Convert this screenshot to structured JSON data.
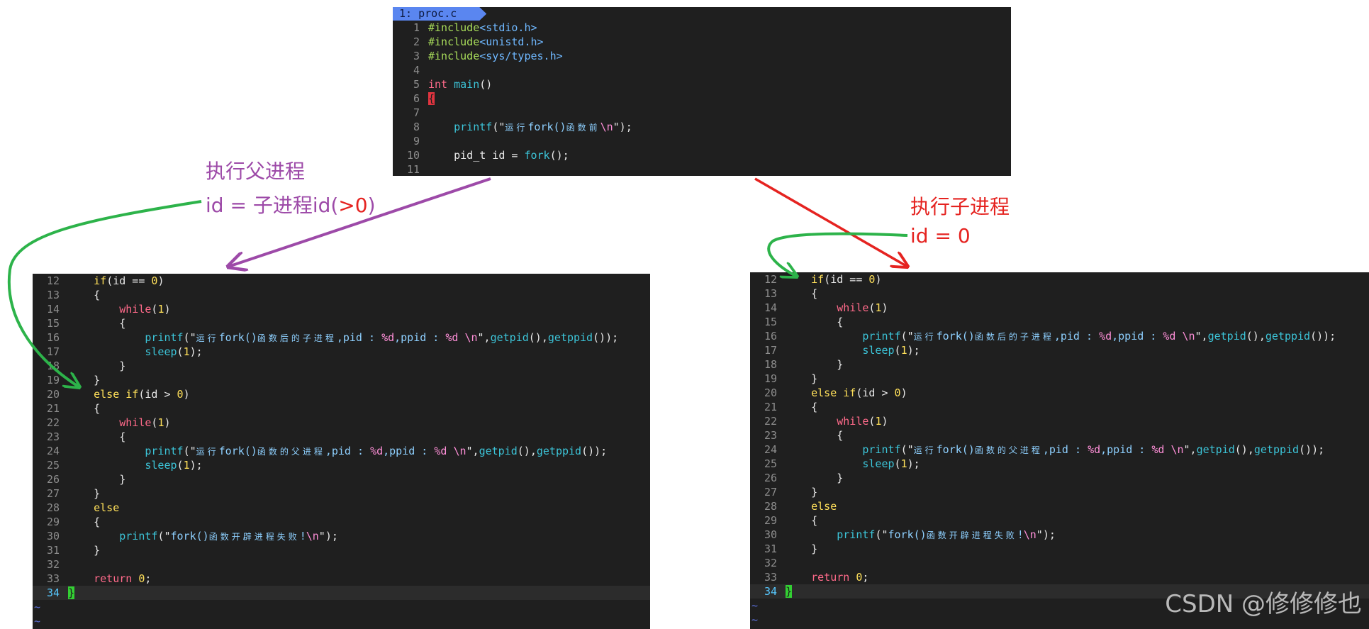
{
  "top_editor": {
    "tab_label": "1: proc.c",
    "lines": [
      {
        "n": "1",
        "segs": [
          {
            "t": "#include",
            "c": "pp"
          },
          {
            "t": "<stdio.h>",
            "c": "inc"
          }
        ]
      },
      {
        "n": "2",
        "segs": [
          {
            "t": "#include",
            "c": "pp"
          },
          {
            "t": "<unistd.h>",
            "c": "inc"
          }
        ]
      },
      {
        "n": "3",
        "segs": [
          {
            "t": "#include",
            "c": "pp"
          },
          {
            "t": "<sys/types.h>",
            "c": "inc"
          }
        ]
      },
      {
        "n": "4",
        "segs": []
      },
      {
        "n": "5",
        "segs": [
          {
            "t": "int ",
            "c": "type"
          },
          {
            "t": "main",
            "c": "fn"
          },
          {
            "t": "()",
            "c": "def"
          }
        ]
      },
      {
        "n": "6",
        "segs": [
          {
            "t": "{",
            "c": "bracehl"
          }
        ]
      },
      {
        "n": "7",
        "segs": []
      },
      {
        "n": "8",
        "segs": [
          {
            "t": "    ",
            "c": "def"
          },
          {
            "t": "printf",
            "c": "fn"
          },
          {
            "t": "(\"",
            "c": "def"
          },
          {
            "t": "运行",
            "c": "str",
            "cjk": true
          },
          {
            "t": "fork()",
            "c": "str"
          },
          {
            "t": "函数前",
            "c": "str",
            "cjk": true
          },
          {
            "t": "\\n",
            "c": "esc"
          },
          {
            "t": "\");",
            "c": "def"
          }
        ]
      },
      {
        "n": "9",
        "segs": []
      },
      {
        "n": "10",
        "segs": [
          {
            "t": "    pid_t id = ",
            "c": "def"
          },
          {
            "t": "fork",
            "c": "fn"
          },
          {
            "t": "();",
            "c": "def"
          }
        ]
      },
      {
        "n": "11",
        "segs": []
      }
    ]
  },
  "lower_editor": {
    "lines": [
      {
        "n": "12",
        "segs": [
          {
            "t": "    ",
            "c": "def"
          },
          {
            "t": "if",
            "c": "kw"
          },
          {
            "t": "(id == ",
            "c": "def"
          },
          {
            "t": "0",
            "c": "num"
          },
          {
            "t": ")",
            "c": "def"
          }
        ]
      },
      {
        "n": "13",
        "segs": [
          {
            "t": "    {",
            "c": "def"
          }
        ]
      },
      {
        "n": "14",
        "segs": [
          {
            "t": "        ",
            "c": "def"
          },
          {
            "t": "while",
            "c": "ctl"
          },
          {
            "t": "(",
            "c": "def"
          },
          {
            "t": "1",
            "c": "num"
          },
          {
            "t": ")",
            "c": "def"
          }
        ]
      },
      {
        "n": "15",
        "segs": [
          {
            "t": "        {",
            "c": "def"
          }
        ]
      },
      {
        "n": "16",
        "segs": [
          {
            "t": "            ",
            "c": "def"
          },
          {
            "t": "printf",
            "c": "fn"
          },
          {
            "t": "(\"",
            "c": "def"
          },
          {
            "t": "运行",
            "c": "str",
            "cjk": true
          },
          {
            "t": "fork()",
            "c": "str"
          },
          {
            "t": "函数后的子进程",
            "c": "str",
            "cjk": true
          },
          {
            "t": ",pid : ",
            "c": "str"
          },
          {
            "t": "%d",
            "c": "esc"
          },
          {
            "t": ",ppid : ",
            "c": "str"
          },
          {
            "t": "%d ",
            "c": "esc"
          },
          {
            "t": "\\n",
            "c": "esc"
          },
          {
            "t": "\",",
            "c": "def"
          },
          {
            "t": "getpid",
            "c": "fn"
          },
          {
            "t": "(),",
            "c": "def"
          },
          {
            "t": "getppid",
            "c": "fn"
          },
          {
            "t": "());",
            "c": "def"
          }
        ]
      },
      {
        "n": "17",
        "segs": [
          {
            "t": "            ",
            "c": "def"
          },
          {
            "t": "sleep",
            "c": "fn"
          },
          {
            "t": "(",
            "c": "def"
          },
          {
            "t": "1",
            "c": "num"
          },
          {
            "t": ");",
            "c": "def"
          }
        ]
      },
      {
        "n": "18",
        "segs": [
          {
            "t": "        }",
            "c": "def"
          }
        ]
      },
      {
        "n": "19",
        "segs": [
          {
            "t": "    }",
            "c": "def"
          }
        ]
      },
      {
        "n": "20",
        "segs": [
          {
            "t": "    ",
            "c": "def"
          },
          {
            "t": "else if",
            "c": "kw"
          },
          {
            "t": "(id > ",
            "c": "def"
          },
          {
            "t": "0",
            "c": "num"
          },
          {
            "t": ")",
            "c": "def"
          }
        ]
      },
      {
        "n": "21",
        "segs": [
          {
            "t": "    {",
            "c": "def"
          }
        ]
      },
      {
        "n": "22",
        "segs": [
          {
            "t": "        ",
            "c": "def"
          },
          {
            "t": "while",
            "c": "ctl"
          },
          {
            "t": "(",
            "c": "def"
          },
          {
            "t": "1",
            "c": "num"
          },
          {
            "t": ")",
            "c": "def"
          }
        ]
      },
      {
        "n": "23",
        "segs": [
          {
            "t": "        {",
            "c": "def"
          }
        ]
      },
      {
        "n": "24",
        "segs": [
          {
            "t": "            ",
            "c": "def"
          },
          {
            "t": "printf",
            "c": "fn"
          },
          {
            "t": "(\"",
            "c": "def"
          },
          {
            "t": "运行",
            "c": "str",
            "cjk": true
          },
          {
            "t": "fork()",
            "c": "str"
          },
          {
            "t": "函数的父进程",
            "c": "str",
            "cjk": true
          },
          {
            "t": ",pid : ",
            "c": "str"
          },
          {
            "t": "%d",
            "c": "esc"
          },
          {
            "t": ",ppid : ",
            "c": "str"
          },
          {
            "t": "%d ",
            "c": "esc"
          },
          {
            "t": "\\n",
            "c": "esc"
          },
          {
            "t": "\",",
            "c": "def"
          },
          {
            "t": "getpid",
            "c": "fn"
          },
          {
            "t": "(),",
            "c": "def"
          },
          {
            "t": "getppid",
            "c": "fn"
          },
          {
            "t": "());",
            "c": "def"
          }
        ]
      },
      {
        "n": "25",
        "segs": [
          {
            "t": "            ",
            "c": "def"
          },
          {
            "t": "sleep",
            "c": "fn"
          },
          {
            "t": "(",
            "c": "def"
          },
          {
            "t": "1",
            "c": "num"
          },
          {
            "t": ");",
            "c": "def"
          }
        ]
      },
      {
        "n": "26",
        "segs": [
          {
            "t": "        }",
            "c": "def"
          }
        ]
      },
      {
        "n": "27",
        "segs": [
          {
            "t": "    }",
            "c": "def"
          }
        ]
      },
      {
        "n": "28",
        "segs": [
          {
            "t": "    ",
            "c": "def"
          },
          {
            "t": "else",
            "c": "kw"
          }
        ]
      },
      {
        "n": "29",
        "segs": [
          {
            "t": "    {",
            "c": "def"
          }
        ]
      },
      {
        "n": "30",
        "segs": [
          {
            "t": "        ",
            "c": "def"
          },
          {
            "t": "printf",
            "c": "fn"
          },
          {
            "t": "(\"",
            "c": "def"
          },
          {
            "t": "fork()",
            "c": "str"
          },
          {
            "t": "函数开辟进程失败",
            "c": "str",
            "cjk": true
          },
          {
            "t": "!",
            "c": "str"
          },
          {
            "t": "\\n",
            "c": "esc"
          },
          {
            "t": "\");",
            "c": "def"
          }
        ]
      },
      {
        "n": "31",
        "segs": [
          {
            "t": "    }",
            "c": "def"
          }
        ]
      },
      {
        "n": "32",
        "segs": []
      },
      {
        "n": "33",
        "segs": [
          {
            "t": "    ",
            "c": "def"
          },
          {
            "t": "return ",
            "c": "ctl"
          },
          {
            "t": "0",
            "c": "num"
          },
          {
            "t": ";",
            "c": "def"
          }
        ]
      },
      {
        "n": "34",
        "segs": [
          {
            "t": "}",
            "c": "bracecur"
          }
        ],
        "current": true
      }
    ],
    "tildes": [
      "~",
      "~"
    ]
  },
  "annotations": {
    "parent_title": "执行父进程",
    "parent_id_prefix": "id = 子进程id(",
    "parent_id_cond": ">0",
    "parent_id_suffix": ")",
    "child_title": "执行子进程",
    "child_id": "id = 0"
  },
  "colors": {
    "purple": "#9d4aa8",
    "red": "#e52320",
    "green": "#2db34a"
  },
  "watermark": "CSDN @修修修也"
}
